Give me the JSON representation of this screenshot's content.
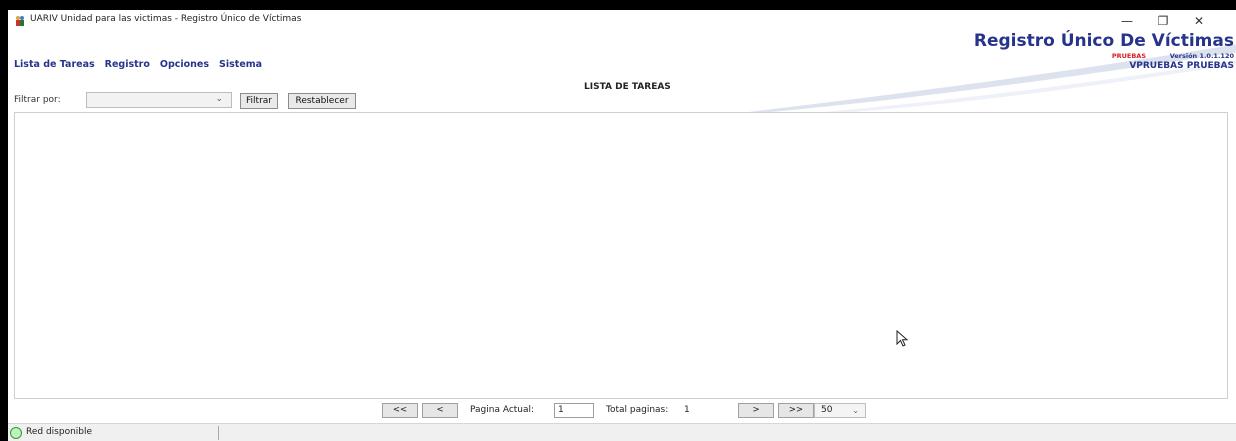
{
  "window": {
    "title": "UARIV Unidad para las victimas - Registro Único de Víctimas",
    "minimize_glyph": "—",
    "restore_glyph": "❐",
    "close_glyph": "✕",
    "icon": "app-icon"
  },
  "branding": {
    "title": "Registro Único De Víctimas",
    "environment": "PRUEBAS",
    "version": "Versión 1.0.1.120",
    "user": "VPRUEBAS PRUEBAS",
    "colors": {
      "primary": "#27348b",
      "environment": "#d61f26"
    }
  },
  "menu": {
    "items": [
      {
        "label": "Lista de Tareas"
      },
      {
        "label": "Registro"
      },
      {
        "label": "Opciones"
      },
      {
        "label": "Sistema"
      }
    ]
  },
  "main": {
    "section_title": "LISTA DE TAREAS"
  },
  "filter": {
    "label": "Filtrar por:",
    "selected_value": "",
    "filter_button": "Filtrar",
    "reset_button": "Restablecer"
  },
  "pager": {
    "first": "<<",
    "prev": "<",
    "current_label": "Pagina Actual:",
    "current_value": "1",
    "total_label": "Total paginas:",
    "total_value": "1",
    "next": ">",
    "last": ">>",
    "page_size": "50"
  },
  "status": {
    "text": "Red disponible",
    "indicator_color": "#2e9b2e"
  }
}
